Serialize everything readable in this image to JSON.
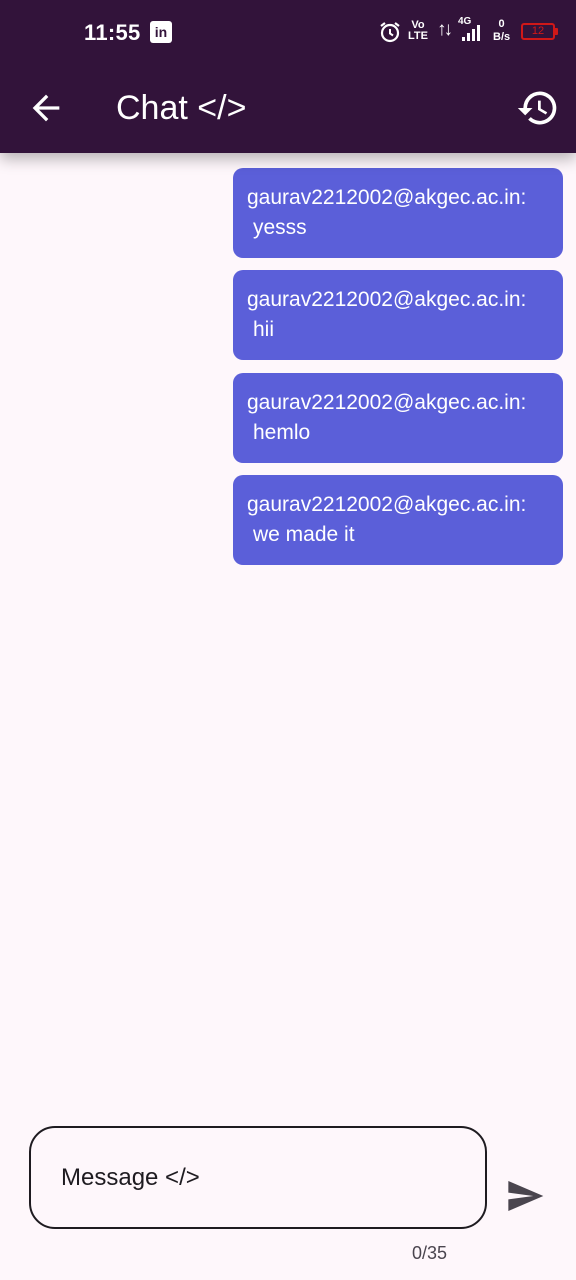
{
  "status_bar": {
    "time": "11:55",
    "linkedin_glyph": "in",
    "volte_top": "Vo",
    "volte_bottom": "LTE",
    "network_type": "4G",
    "net_speed_value": "0",
    "net_speed_unit": "B/s",
    "battery_level": "12",
    "icons": [
      "linkedin-icon",
      "alarm-icon",
      "volte-icon",
      "data-arrows-icon",
      "signal-icon",
      "battery-icon"
    ]
  },
  "app_bar": {
    "title": "Chat </>",
    "background_color": "#32133a",
    "back_icon": "arrow-left-icon",
    "history_icon": "history-icon"
  },
  "messages": [
    {
      "sender": "gaurav2212002@akgec.ac.in:",
      "text": "yesss"
    },
    {
      "sender": "gaurav2212002@akgec.ac.in:",
      "text": "hii"
    },
    {
      "sender": "gaurav2212002@akgec.ac.in:",
      "text": "hemlo"
    },
    {
      "sender": "gaurav2212002@akgec.ac.in:",
      "text": "we made it"
    }
  ],
  "bubble_color": "#5b5fd9",
  "composer": {
    "placeholder": "Message </>",
    "value": "",
    "counter": "0/35",
    "send_icon": "send-icon"
  }
}
